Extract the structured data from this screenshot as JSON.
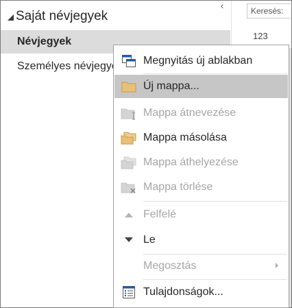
{
  "folder_pane": {
    "collapse_glyph": "‹",
    "group_header": "Saját névjegyek",
    "items": [
      {
        "label": "Névjegyek",
        "selected": true
      },
      {
        "label": "Személyes névjegyek",
        "selected": false
      }
    ]
  },
  "right_pane": {
    "search_placeholder": "Keresés:",
    "index_label": "123"
  },
  "context_menu": {
    "items": [
      {
        "label": "Megnyitás új ablakban",
        "icon": "new-window-icon",
        "enabled": true
      },
      {
        "label": "Új mappa...",
        "icon": "new-folder-icon",
        "enabled": true,
        "highlighted": true
      },
      {
        "label": "Mappa átnevezése",
        "icon": "rename-folder-icon",
        "enabled": false
      },
      {
        "label": "Mappa másolása",
        "icon": "copy-folder-icon",
        "enabled": true
      },
      {
        "label": "Mappa áthelyezése",
        "icon": "move-folder-icon",
        "enabled": false
      },
      {
        "label": "Mappa törlése",
        "icon": "delete-folder-icon",
        "enabled": false
      },
      {
        "label": "Felfelé",
        "icon": "move-up-icon",
        "enabled": false
      },
      {
        "label": "Le",
        "icon": "move-down-icon",
        "enabled": true
      },
      {
        "label": "Megosztás",
        "icon": "",
        "enabled": false,
        "has_submenu": true
      },
      {
        "label": "Tulajdonságok...",
        "icon": "properties-icon",
        "enabled": true
      }
    ]
  },
  "colors": {
    "folder_yellow": "#e8c07a",
    "disabled_text": "#a6a6a6",
    "highlight": "#c6c6c6",
    "selected_folder_bg": "#dcdcdc",
    "accent_blue": "#1e5aa8"
  }
}
